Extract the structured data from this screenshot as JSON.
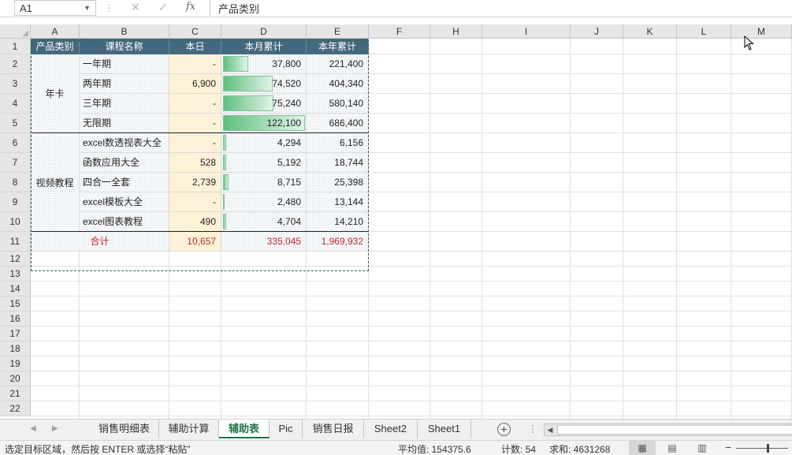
{
  "formula_bar": {
    "name_box": "A1",
    "cancel_glyph": "✕",
    "enter_glyph": "✓",
    "fx_label": "fx",
    "formula": "产品类别"
  },
  "columns": [
    "A",
    "B",
    "C",
    "D",
    "E",
    "F",
    "H",
    "I",
    "J",
    "K",
    "L",
    "M"
  ],
  "rows": [
    "1",
    "2",
    "3",
    "4",
    "5",
    "6",
    "7",
    "8",
    "9",
    "10",
    "11",
    "12",
    "13",
    "14",
    "15",
    "16",
    "17",
    "18",
    "19",
    "20",
    "21",
    "22"
  ],
  "table": {
    "headers": [
      "产品类别",
      "课程名称",
      "本日",
      "本月累计",
      "本年累计"
    ],
    "groups": [
      {
        "category": "年卡",
        "items": [
          {
            "name": "一年期",
            "today": "-",
            "month": "37,800",
            "year": "221,400",
            "month_value": 37800
          },
          {
            "name": "两年期",
            "today": "6,900",
            "month": "74,520",
            "year": "404,340",
            "month_value": 74520
          },
          {
            "name": "三年期",
            "today": "-",
            "month": "75,240",
            "year": "580,140",
            "month_value": 75240
          },
          {
            "name": "无限期",
            "today": "-",
            "month": "122,100",
            "year": "686,400",
            "month_value": 122100
          }
        ]
      },
      {
        "category": "视频教程",
        "items": [
          {
            "name": "excel数透视表大全",
            "today": "-",
            "month": "4,294",
            "year": "6,156",
            "month_value": 4294
          },
          {
            "name": "函数应用大全",
            "today": "528",
            "month": "5,192",
            "year": "18,744",
            "month_value": 5192
          },
          {
            "name": "四合一全套",
            "today": "2,739",
            "month": "8,715",
            "year": "25,398",
            "month_value": 8715
          },
          {
            "name": "excel模板大全",
            "today": "-",
            "month": "2,480",
            "year": "13,144",
            "month_value": 2480
          },
          {
            "name": "excel图表教程",
            "today": "490",
            "month": "4,704",
            "year": "14,210",
            "month_value": 4704
          }
        ]
      }
    ],
    "total": {
      "label": "合计",
      "today": "10,657",
      "month": "335,045",
      "year": "1,969,932"
    },
    "month_bar_max": 122100
  },
  "sheet_tabs": [
    "销售明细表",
    "辅助计算",
    "辅助表",
    "Pic",
    "销售日报",
    "Sheet2",
    "Sheet1"
  ],
  "active_tab": "辅助表",
  "status": {
    "message": "选定目标区域，然后按 ENTER 或选择“粘贴”",
    "average": "平均值: 154375.6",
    "count": "计数: 54",
    "sum": "求和: 4631268"
  },
  "colors": {
    "header_bg": "#44697f",
    "today_bg": "#fdf2d8",
    "total_text": "#c0282d",
    "active_tab": "#1f7244",
    "databar": "#5fbf7f"
  }
}
